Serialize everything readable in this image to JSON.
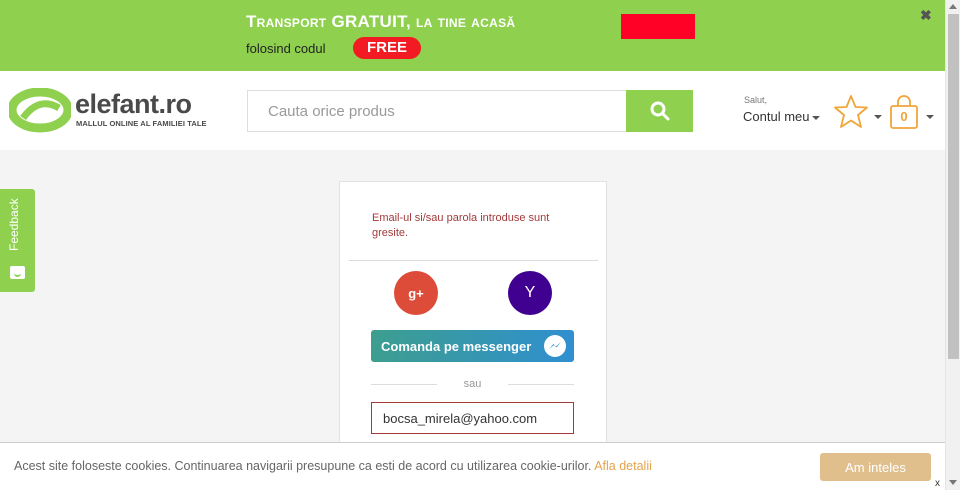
{
  "promo": {
    "title": "Transport GRATUIT, la tine acasă",
    "line": "folosind codul",
    "code": "FREE",
    "close": "✖"
  },
  "header": {
    "logo_word": "elefant.ro",
    "logo_tagline": "MALLUL ONLINE AL FAMILIEI TALE",
    "search_placeholder": "Cauta orice produs",
    "greeting": "Salut,",
    "account_label": "Contul meu",
    "cart_count": "0"
  },
  "feedback": {
    "label": "Feedback"
  },
  "login": {
    "error": "Email-ul si/sau parola introduse sunt gresite.",
    "google_label": "g+",
    "yahoo_label": "Y",
    "messenger_label": "Comanda pe messenger",
    "or_text": "sau",
    "email_value": "bocsa_mirela@yahoo.com"
  },
  "cookie": {
    "text": "Acest site foloseste cookies. Continuarea navigarii presupune ca esti de acord cu utilizarea cookie-urilor.",
    "link": "Afla detalii",
    "button": "Am inteles",
    "close": "x"
  },
  "colors": {
    "brand_green": "#8fd14f",
    "promo_red": "#f21b24",
    "error_red": "#a33a3a",
    "cookie_button": "#e0bf8d",
    "accent_orange": "#f0a53a"
  }
}
